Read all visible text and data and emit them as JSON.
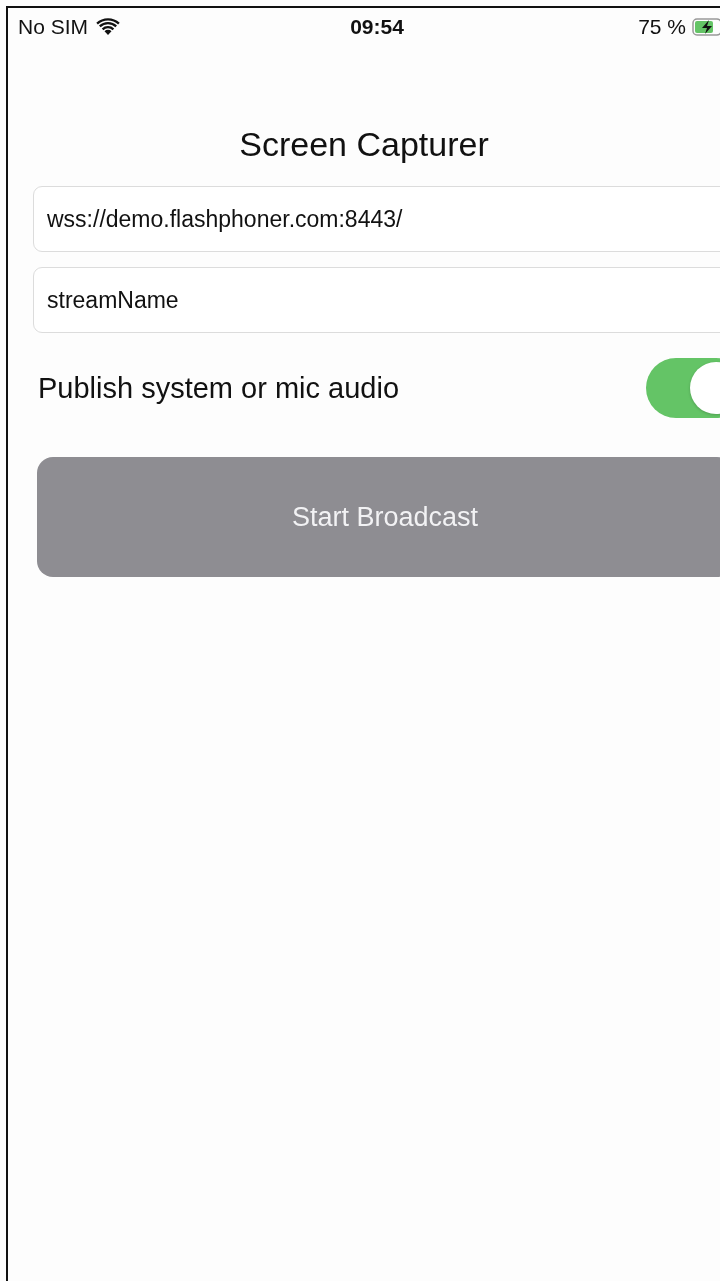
{
  "status_bar": {
    "carrier": "No SIM",
    "time": "09:54",
    "battery": "75 %"
  },
  "title": "Screen Capturer",
  "fields": [
    {
      "value": "wss://demo.flashphoner.com:8443/"
    },
    {
      "value": "streamName"
    }
  ],
  "audio_toggle": {
    "label": "Publish system or mic audio",
    "on": true
  },
  "start_button": {
    "label": "Start Broadcast",
    "disabled": true
  }
}
